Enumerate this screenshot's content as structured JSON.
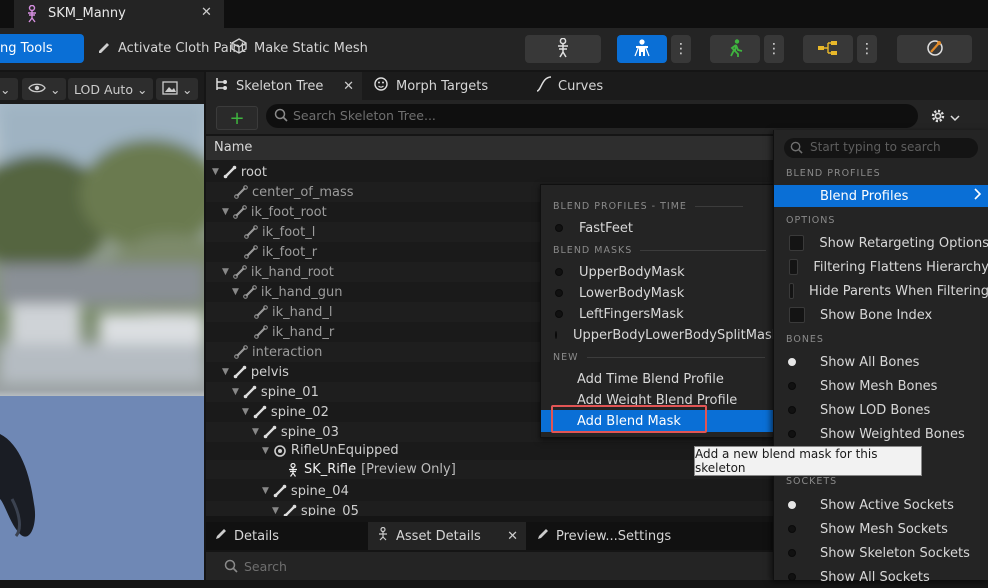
{
  "window": {
    "tab_title": "SKM_Manny",
    "close_glyph": "✕"
  },
  "toolbar": {
    "left_label": "ng Tools",
    "cloth_label": "Activate Cloth Paint",
    "static_mesh_label": "Make Static Mesh",
    "more_glyph": "⋮"
  },
  "viewport": {
    "lod_label": "LOD Auto",
    "chevron": "⌄"
  },
  "panels": {
    "skeleton_tree": "Skeleton Tree",
    "morph_targets": "Morph Targets",
    "curves": "Curves",
    "close_glyph": "✕",
    "add_glyph": "+",
    "search_placeholder": "Search Skeleton Tree...",
    "column_name": "Name"
  },
  "tree": [
    {
      "label": "root",
      "suffix": ""
    },
    {
      "label": "center_of_mass",
      "suffix": ""
    },
    {
      "label": "ik_foot_root",
      "suffix": ""
    },
    {
      "label": "ik_foot_l",
      "suffix": ""
    },
    {
      "label": "ik_foot_r",
      "suffix": ""
    },
    {
      "label": "ik_hand_root",
      "suffix": ""
    },
    {
      "label": "ik_hand_gun",
      "suffix": ""
    },
    {
      "label": "ik_hand_l",
      "suffix": ""
    },
    {
      "label": "ik_hand_r",
      "suffix": ""
    },
    {
      "label": "interaction",
      "suffix": ""
    },
    {
      "label": "pelvis",
      "suffix": ""
    },
    {
      "label": "spine_01",
      "suffix": ""
    },
    {
      "label": "spine_02",
      "suffix": ""
    },
    {
      "label": "spine_03",
      "suffix": ""
    },
    {
      "label": "RifleUnEquipped",
      "suffix": ""
    },
    {
      "label": "SK_Rifle",
      "suffix": "[Preview Only]"
    },
    {
      "label": "spine_04",
      "suffix": ""
    },
    {
      "label": "spine_05",
      "suffix": ""
    }
  ],
  "menu_left": {
    "sec_time": "BLEND PROFILES - TIME",
    "fastfeet": "FastFeet",
    "sec_masks": "BLEND MASKS",
    "masks": [
      "UpperBodyMask",
      "LowerBodyMask",
      "LeftFingersMask",
      "UpperBodyLowerBodySplitMask"
    ],
    "sec_new": "NEW",
    "new_items": [
      "Add Time Blend Profile",
      "Add Weight Blend Profile",
      "Add Blend Mask"
    ]
  },
  "menu_right": {
    "search_placeholder": "Start typing to search",
    "sec_profiles": "BLEND PROFILES",
    "blend_profiles": "Blend Profiles",
    "sec_options": "OPTIONS",
    "options": [
      "Show Retargeting Options",
      "Filtering Flattens Hierarchy",
      "Hide Parents When Filtering",
      "Show Bone Index"
    ],
    "sec_bones": "BONES",
    "bones": [
      "Show All Bones",
      "Show Mesh Bones",
      "Show LOD Bones",
      "Show Weighted Bones"
    ],
    "sec_sockets": "SOCKETS",
    "sockets": [
      "Show Active Sockets",
      "Show Mesh Sockets",
      "Show Skeleton Sockets",
      "Show All Sockets"
    ]
  },
  "tooltip": "Add a new blend mask for this skeleton",
  "bottom": {
    "details": "Details",
    "asset_details": "Asset Details",
    "preview_settings": "Preview...Settings",
    "close_glyph": "✕",
    "search_placeholder": "Search"
  },
  "colors": {
    "accent": "#0a6fd6",
    "highlight": "#e25555",
    "add_green": "#3fb53f"
  }
}
